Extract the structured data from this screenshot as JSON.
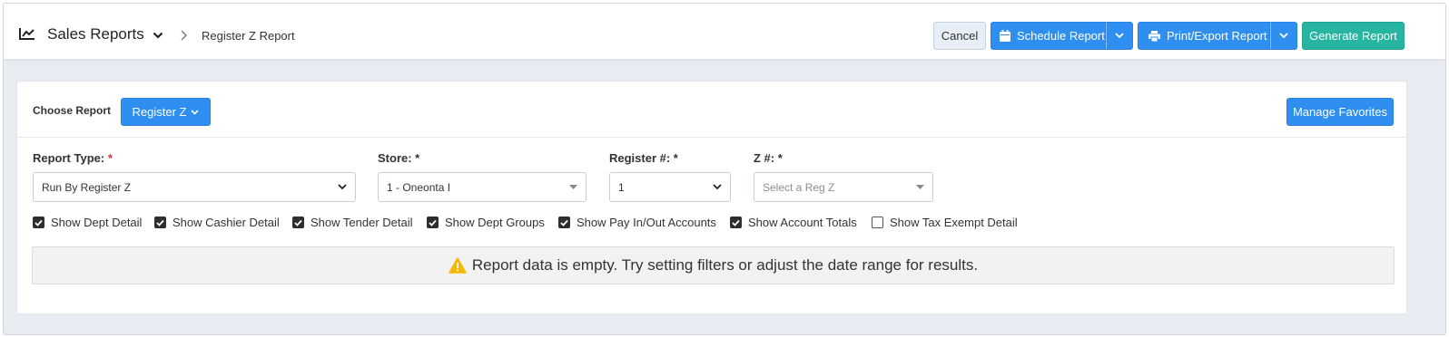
{
  "header": {
    "icon": "line-chart-icon",
    "title": "Sales Reports",
    "breadcrumb": "Register Z Report",
    "buttons": {
      "cancel": "Cancel",
      "schedule": "Schedule Report",
      "print_export": "Print/Export Report",
      "generate": "Generate Report"
    }
  },
  "chooser": {
    "label": "Choose Report",
    "selected": "Register Z",
    "manage_favorites": "Manage Favorites"
  },
  "filters": {
    "report_type": {
      "label": "Report Type:",
      "required_mark": "*",
      "value": "Run By Register Z"
    },
    "store": {
      "label": "Store: *",
      "value": "1 - Oneonta I"
    },
    "register": {
      "label": "Register #: *",
      "value": "1"
    },
    "z_number": {
      "label": "Z #: *",
      "placeholder": "Select a Reg Z"
    }
  },
  "options": [
    {
      "label": "Show Dept Detail",
      "checked": true
    },
    {
      "label": "Show Cashier Detail",
      "checked": true
    },
    {
      "label": "Show Tender Detail",
      "checked": true
    },
    {
      "label": "Show Dept Groups",
      "checked": true
    },
    {
      "label": "Show Pay In/Out Accounts",
      "checked": true
    },
    {
      "label": "Show Account Totals",
      "checked": true
    },
    {
      "label": "Show Tax Exempt Detail",
      "checked": false
    }
  ],
  "message": {
    "icon": "warning-icon",
    "text": "Report data is empty. Try setting filters or adjust the date range for results."
  },
  "colors": {
    "primary": "#2f8ff0",
    "success": "#27b4a1",
    "warning": "#f5b800",
    "required": "#d9343a"
  }
}
